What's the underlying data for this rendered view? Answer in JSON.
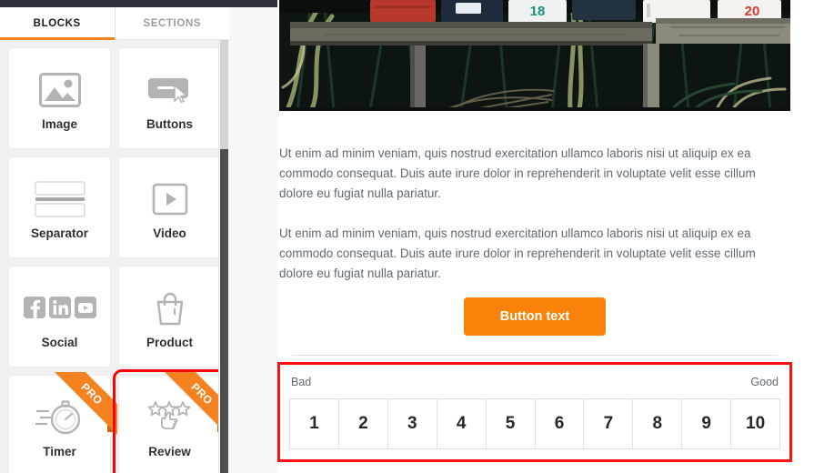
{
  "sidebar": {
    "tabs": [
      {
        "label": "BLOCKS",
        "active": true
      },
      {
        "label": "SECTIONS",
        "active": false
      }
    ],
    "blocks": [
      {
        "label": "Image",
        "icon": "image-icon",
        "pro": false,
        "selected": false
      },
      {
        "label": "Buttons",
        "icon": "button-icon",
        "pro": false,
        "selected": false
      },
      {
        "label": "Separator",
        "icon": "separator-icon",
        "pro": false,
        "selected": false
      },
      {
        "label": "Video",
        "icon": "video-icon",
        "pro": false,
        "selected": false
      },
      {
        "label": "Social",
        "icon": "social-icon",
        "pro": false,
        "selected": false
      },
      {
        "label": "Product",
        "icon": "product-icon",
        "pro": false,
        "selected": false
      },
      {
        "label": "Timer",
        "icon": "timer-icon",
        "pro": true,
        "selected": false
      },
      {
        "label": "Review",
        "icon": "review-icon",
        "pro": true,
        "selected": true
      }
    ],
    "pro_badge_label": "PRO"
  },
  "canvas": {
    "hero_image_alt": "row-of-mailboxes-photo",
    "paragraphs": [
      "Ut enim ad minim veniam, quis nostrud exercitation ullamco laboris nisi ut aliquip ex ea commodo consequat. Duis aute irure dolor in reprehenderit in voluptate velit esse cillum dolore eu fugiat nulla pariatur.",
      "Ut enim ad minim veniam, quis nostrud exercitation ullamco laboris nisi ut aliquip ex ea commodo consequat. Duis aute irure dolor in reprehenderit in voluptate velit esse cillum dolore eu fugiat nulla pariatur."
    ],
    "cta_button_label": "Button text",
    "rating": {
      "low_label": "Bad",
      "high_label": "Good",
      "options": [
        "1",
        "2",
        "3",
        "4",
        "5",
        "6",
        "7",
        "8",
        "9",
        "10"
      ]
    }
  },
  "colors": {
    "accent_orange": "#f58220",
    "cta_orange": "#f9820a",
    "selection_red": "#ff1010",
    "topbar_dark": "#2d3238",
    "panel_bg": "#f1f1f1",
    "body_text": "#5f6a73"
  }
}
